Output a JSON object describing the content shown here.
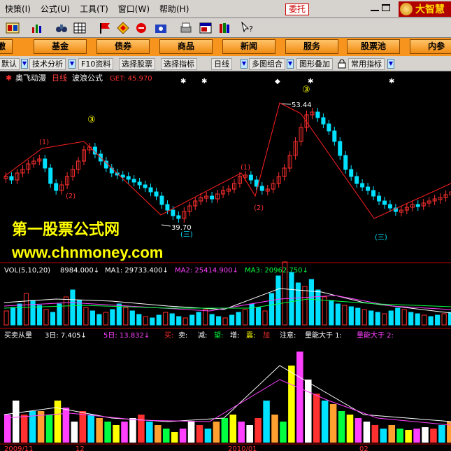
{
  "menubar": {
    "items": [
      "快策(I)",
      "公式(U)",
      "工具(T)",
      "窗口(W)",
      "帮助(H)"
    ],
    "commission": "委托",
    "brand": "大智慧"
  },
  "toolbar": {
    "icons": [
      "layout-icon",
      "chart-icon",
      "binoculars-icon",
      "flag-icon",
      "diamond-icon",
      "stop-icon",
      "portfolio-icon",
      "print-icon",
      "window-icon",
      "books-icon",
      "help-cursor-icon"
    ]
  },
  "nav": [
    "撤",
    "基金",
    "债券",
    "商品",
    "新闻",
    "服务",
    "股票池",
    "内参"
  ],
  "subbar": {
    "items": [
      "默认",
      "技术分析",
      "F10资料",
      "选择股票",
      "选择指标",
      "日线",
      "多图组合",
      "图形叠加",
      "常用指标"
    ]
  },
  "main_chart": {
    "stock_name": "奥飞动漫",
    "period": "日线",
    "indicator": "波浪公式",
    "get_label": "GET: 45.970",
    "high_label": "53.44",
    "low_label": "39.70",
    "wave_labels": [
      "③",
      "(1)",
      "(2)",
      "(1)",
      "(2)",
      "③",
      "(三)",
      "(三)"
    ],
    "watermark_1": "第一股票公式网",
    "watermark_2": "www.chnmoney.com"
  },
  "volume_panel": {
    "label": "VOL(5,10,20)",
    "vol": "8984.000↓",
    "ma1": "MA1: 29733.400↓",
    "ma2": "MA2: 25414.900↓",
    "ma3": "MA3: 20962.750↓"
  },
  "indicator_panel": {
    "name": "买卖从量",
    "day3": "3日: 7.405↓",
    "day5": "5日: 13.832↓",
    "tags": [
      "买:",
      "卖:",
      "减:",
      "望:",
      "增:",
      "震:",
      "加",
      "注意:",
      "量能大于 1:",
      "量能大于 2:"
    ]
  },
  "date_axis": [
    "2009/11",
    "12",
    "2010/01",
    "02"
  ],
  "colors": {
    "menubar_bg": "#d6d3ce",
    "nav_bg": "#f7941d",
    "up_candle": "#ff3030",
    "down_candle": "#00e0ff",
    "wave_line": "#ff2020",
    "watermark": "#ffff00"
  }
}
